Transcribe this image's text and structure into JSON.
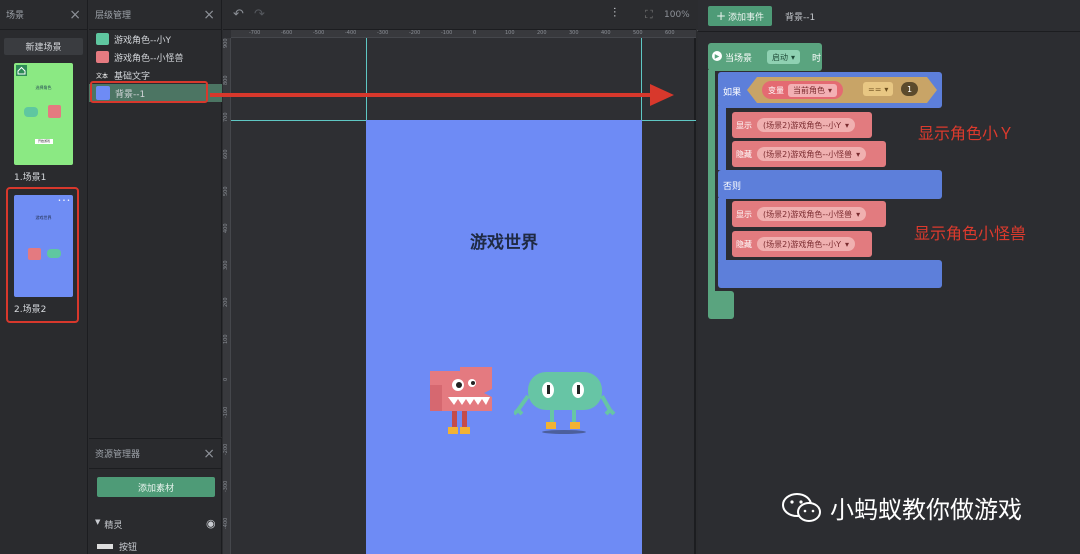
{
  "scene_panel": {
    "title": "场景",
    "new_scene_label": "新建场景",
    "thumbs": [
      {
        "label": "1.场景1",
        "inner_title": "选择角色",
        "inner_button": "开始游戏"
      },
      {
        "label": "2.场景2",
        "inner_title": "游戏世界",
        "menu": "• • •"
      }
    ]
  },
  "layer_panel": {
    "title": "层级管理",
    "items": [
      {
        "label": "游戏角色--小Y"
      },
      {
        "label": "游戏角色--小怪兽"
      },
      {
        "label": "基础文字",
        "icon_text": "文本"
      },
      {
        "label": "背景--1"
      }
    ]
  },
  "resource_panel": {
    "title": "资源管理器",
    "add_label": "添加素材",
    "section": "精灵",
    "item": "按钮"
  },
  "canvas": {
    "zoom": "100%",
    "stage_title": "游戏世界",
    "ruler_x": [
      "-700",
      "-600",
      "-500",
      "-400",
      "-300",
      "-200",
      "-100",
      "0",
      "100",
      "200",
      "300",
      "400",
      "500",
      "600",
      "700"
    ],
    "ruler_y": [
      "900",
      "800",
      "700",
      "600",
      "500",
      "400",
      "300",
      "200",
      "100",
      "0",
      "-100",
      "-200",
      "-300",
      "-400"
    ]
  },
  "event_panel": {
    "add_event_label": "添加事件",
    "target": "背景--1",
    "when": {
      "scene": "当场景",
      "trigger": "启动",
      "suffix": "时"
    },
    "if": {
      "label": "如果",
      "var_label": "变量",
      "var_name": "当前角色",
      "op": "==",
      "value": "1"
    },
    "then": [
      {
        "action": "显示",
        "target": "(场景2)游戏角色--小Y"
      },
      {
        "action": "隐藏",
        "target": "(场景2)游戏角色--小怪兽"
      }
    ],
    "else_label": "否则",
    "else": [
      {
        "action": "显示",
        "target": "(场景2)游戏角色--小怪兽"
      },
      {
        "action": "隐藏",
        "target": "(场景2)游戏角色--小Y"
      }
    ]
  },
  "annotations": {
    "show_y": "显示角色小Ｙ",
    "show_monster": "显示角色小怪兽"
  },
  "watermark": "小蚂蚁教你做游戏",
  "colors": {
    "highlight": "#d8382c",
    "accent": "#4e9b77",
    "stage": "#6e8bf5"
  }
}
